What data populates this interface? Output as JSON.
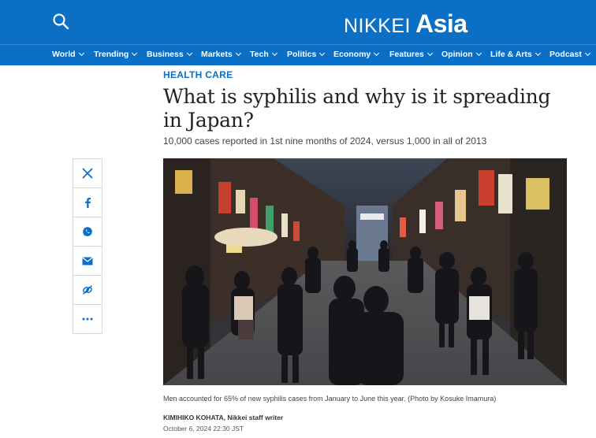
{
  "header": {
    "brand_nikkei": "NIKKEI",
    "brand_asia": "Asia",
    "search_icon": "search-icon"
  },
  "nav": {
    "items": [
      {
        "label": "World"
      },
      {
        "label": "Trending"
      },
      {
        "label": "Business"
      },
      {
        "label": "Markets"
      },
      {
        "label": "Tech"
      },
      {
        "label": "Politics"
      },
      {
        "label": "Economy"
      },
      {
        "label": "Features"
      },
      {
        "label": "Opinion"
      },
      {
        "label": "Life & Arts"
      },
      {
        "label": "Podcast"
      }
    ]
  },
  "article": {
    "section": "HEALTH CARE",
    "headline": "What is syphilis and why is it spreading in Japan?",
    "subhead": "10,000 cases reported in 1st nine months of 2024, versus 1,000 in all of 2013",
    "caption": "Men accounted for 65% of new syphilis cases from January to June this year. (Photo by Kosuke Imamura)",
    "author": "KIMIHIKO KOHATA, Nikkei staff writer",
    "date": "October 6, 2024 22:30 JST"
  },
  "share": {
    "icons": [
      "x-icon",
      "facebook-icon",
      "whatsapp-icon",
      "email-icon",
      "link-icon",
      "more-icon"
    ]
  },
  "colors": {
    "brand_blue": "#0b6fc6",
    "text_dark": "#222222"
  }
}
